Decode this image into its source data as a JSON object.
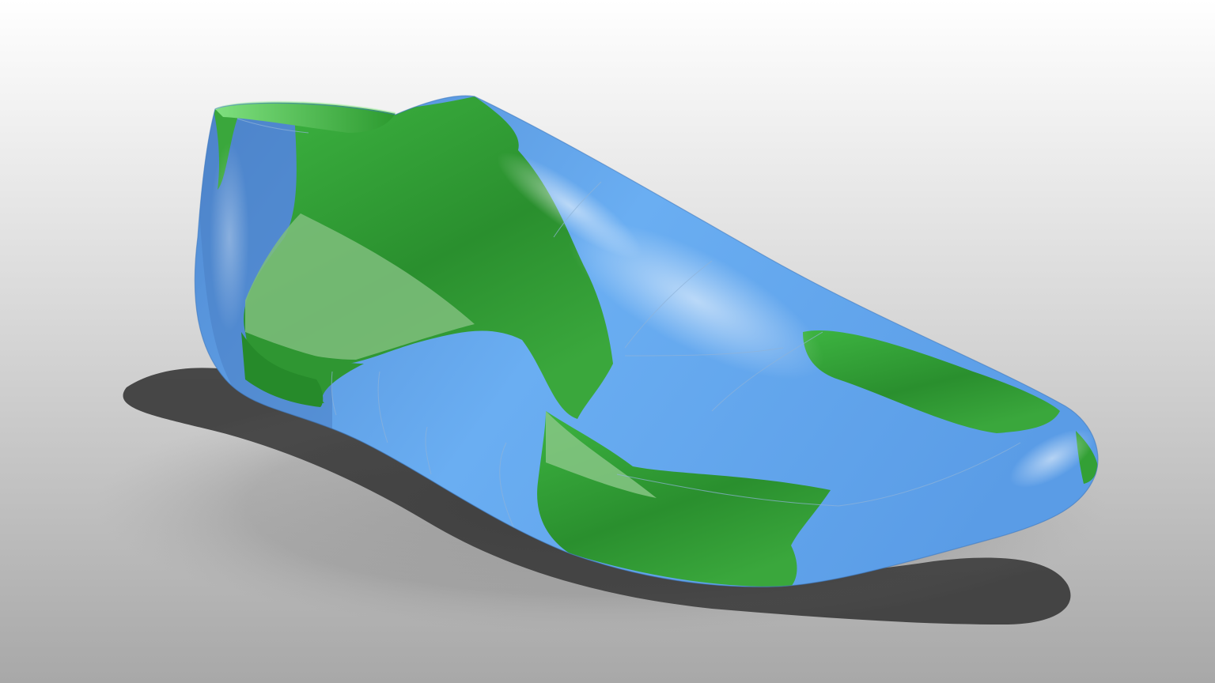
{
  "scene": {
    "subject": "shoe-last",
    "colors": {
      "background_top": "#ffffff",
      "background_bottom": "#a9a9a9",
      "surface_blue": "#62a8ef",
      "surface_blue_shade": "#3f7fcc",
      "surface_green": "#33a035",
      "surface_green_shade": "#1e7a24",
      "shadow": "#3a3a3a"
    }
  }
}
